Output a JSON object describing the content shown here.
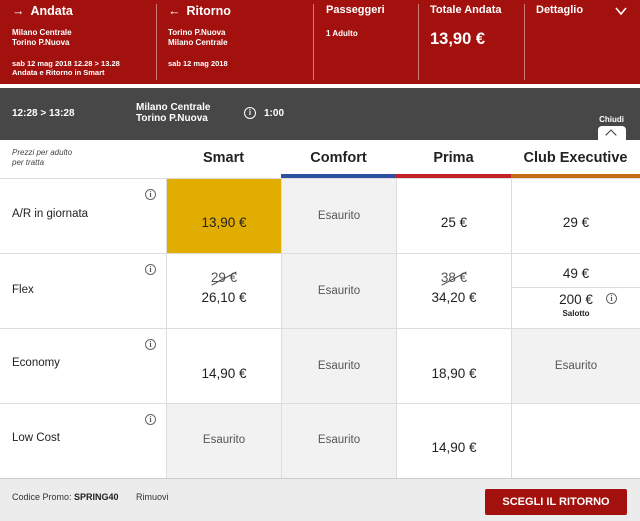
{
  "header": {
    "andata": {
      "label": "Andata",
      "from": "Milano Centrale",
      "to": "Torino P.Nuova",
      "datetime": "sab 12 mag 2018 12.28 > 13.28",
      "note": "Andata e Ritorno in Smart"
    },
    "ritorno": {
      "label": "Ritorno",
      "from": "Torino P.Nuova",
      "to": "Milano Centrale",
      "date": "sab 12 mag 2018"
    },
    "passeggeri": {
      "label": "Passeggeri",
      "value": "1 Adulto"
    },
    "totale": {
      "label": "Totale Andata",
      "value": "13,90 €"
    },
    "dettaglio": {
      "label": "Dettaglio"
    }
  },
  "trip": {
    "times": "12:28 > 13:28",
    "from": "Milano Centrale",
    "to": "Torino P.Nuova",
    "duration": "1:00",
    "close_label": "Chiudi"
  },
  "table": {
    "note_line1": "Prezzi per adulto",
    "note_line2": "per tratta",
    "columns": [
      {
        "name": "Smart",
        "color": "#e1ad00"
      },
      {
        "name": "Comfort",
        "color": "#2f4fa0"
      },
      {
        "name": "Prima",
        "color": "#c4212b"
      },
      {
        "name": "Club Executive",
        "color": "#c66a15"
      }
    ],
    "rows": [
      {
        "label": "A/R in giornata",
        "smart": "13,90 €",
        "comfort": "Esaurito",
        "prima": "25 €",
        "club": "29 €"
      },
      {
        "label": "Flex",
        "smart_old": "29 €",
        "smart": "26,10 €",
        "comfort": "Esaurito",
        "prima_old": "38 €",
        "prima": "34,20 €",
        "club": "49 €",
        "club_salotto": "200 €",
        "club_salotto_label": "Salotto"
      },
      {
        "label": "Economy",
        "smart": "14,90 €",
        "comfort": "Esaurito",
        "prima": "18,90 €",
        "club": "Esaurito"
      },
      {
        "label": "Low Cost",
        "smart": "Esaurito",
        "comfort": "Esaurito",
        "prima": "14,90 €",
        "club": ""
      }
    ]
  },
  "footer": {
    "promo_label": "Codice Promo:",
    "promo_code": "SPRING40",
    "remove_label": "Rimuovi",
    "cta_label": "SCEGLI IL RITORNO"
  },
  "colors": {
    "brand_red": "#a3110e",
    "trip_bar": "#474747",
    "selected": "#e1ad00"
  }
}
